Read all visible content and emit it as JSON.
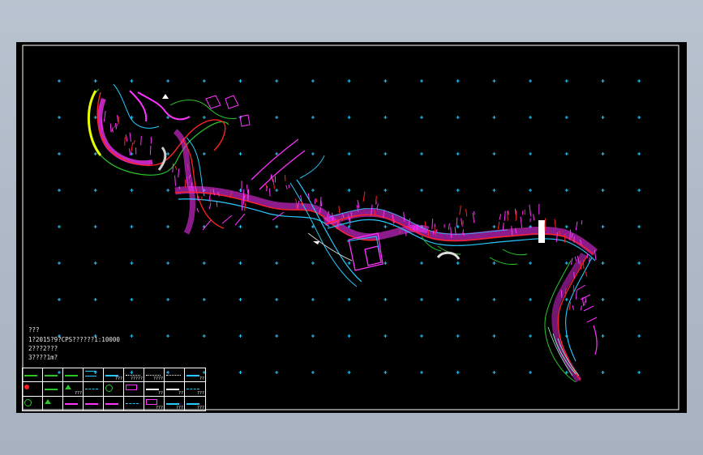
{
  "notes": {
    "line1": "???",
    "line2": "1?2015?9?CPS??????1:10000",
    "line3": "2???2???",
    "line4": "3????1m?"
  },
  "legend": {
    "items": [
      {
        "label": "",
        "color": "#29c529",
        "symbol": "line"
      },
      {
        "label": "",
        "color": "#29c529",
        "symbol": "line"
      },
      {
        "label": "",
        "color": "#29c529",
        "symbol": "line"
      },
      {
        "label": "",
        "color": "#28c8ff",
        "symbol": "double"
      },
      {
        "label": "???",
        "color": "#28c8ff",
        "symbol": "line"
      },
      {
        "label": "?????",
        "color": "#ffffff",
        "symbol": "ticks"
      },
      {
        "label": "????",
        "color": "#ffffff",
        "symbol": "ticks"
      },
      {
        "label": "",
        "color": "#ffffff",
        "symbol": "ticks"
      },
      {
        "label": "??",
        "color": "#28c8ff",
        "symbol": "line"
      },
      {
        "label": "",
        "color": "#ff2222",
        "symbol": "dot"
      },
      {
        "label": "",
        "color": "#29c529",
        "symbol": "line"
      },
      {
        "label": "???",
        "color": "#29c529",
        "symbol": "tree"
      },
      {
        "label": "",
        "color": "#28c8ff",
        "symbol": "wave"
      },
      {
        "label": "",
        "color": "#29c529",
        "symbol": "circle"
      },
      {
        "label": "",
        "color": "#ff33ff",
        "symbol": "box"
      },
      {
        "label": "??",
        "color": "#ffffff",
        "symbol": "line"
      },
      {
        "label": "??",
        "color": "#ffffff",
        "symbol": "line"
      },
      {
        "label": "???",
        "color": "#28c8ff",
        "symbol": "wave"
      },
      {
        "label": "",
        "color": "#29c529",
        "symbol": "circle"
      },
      {
        "label": "",
        "color": "#29c529",
        "symbol": "tree"
      },
      {
        "label": "",
        "color": "#ff33ff",
        "symbol": "line"
      },
      {
        "label": "",
        "color": "#ff33ff",
        "symbol": "line"
      },
      {
        "label": "",
        "color": "#ff33ff",
        "symbol": "line"
      },
      {
        "label": "",
        "color": "#28c8ff",
        "symbol": "wave"
      },
      {
        "label": "???",
        "color": "#ff33ff",
        "symbol": "box"
      },
      {
        "label": "???",
        "color": "#28c8ff",
        "symbol": "line"
      },
      {
        "label": "???",
        "color": "#28c8ff",
        "symbol": "line"
      }
    ]
  }
}
